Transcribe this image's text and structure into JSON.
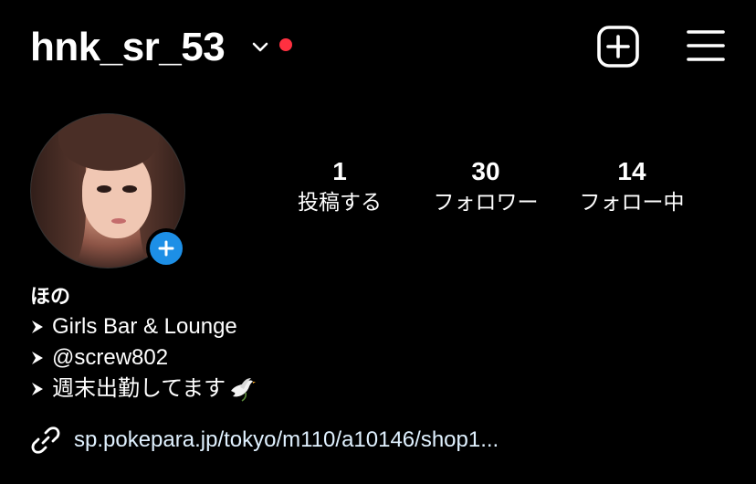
{
  "header": {
    "username": "hnk_sr_53",
    "has_notification": true
  },
  "stats": [
    {
      "value": "1",
      "label": "投稿する"
    },
    {
      "value": "30",
      "label": "フォロワー"
    },
    {
      "value": "14",
      "label": "フォロー中"
    }
  ],
  "bio": {
    "name": "ほの",
    "lines": [
      "Girls Bar & Lounge",
      "@screw802",
      "週末出勤してます"
    ]
  },
  "link": {
    "text": "sp.pokepara.jp/tokyo/m110/a10146/shop1..."
  },
  "colors": {
    "notification_dot": "#ff3040",
    "add_story_badge": "#1d8fe6",
    "background": "#000000"
  }
}
